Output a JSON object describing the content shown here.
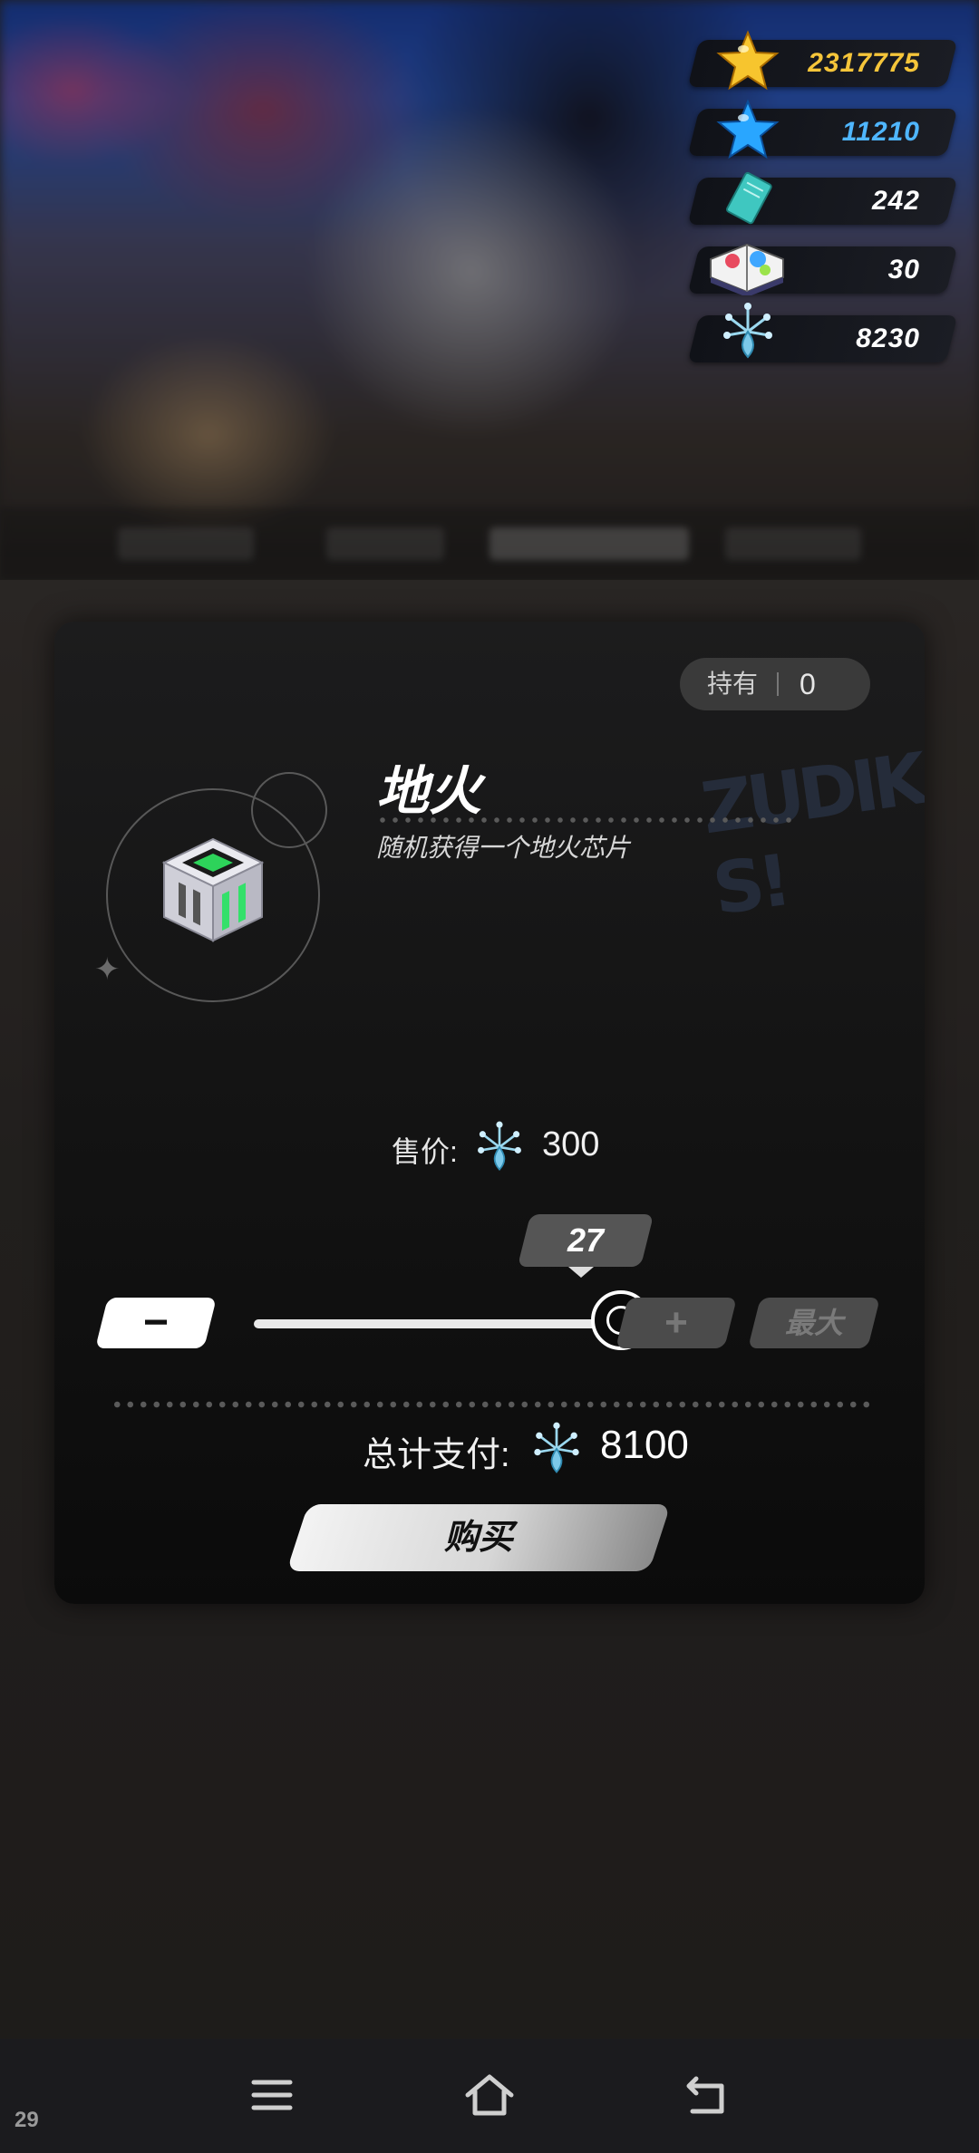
{
  "currencies": [
    {
      "name": "gold-star",
      "value": "2317775",
      "color": "#f5c53a"
    },
    {
      "name": "blue-star",
      "value": "11210",
      "color": "#4fb6ff"
    },
    {
      "name": "card",
      "value": "242",
      "color": "#ffffff"
    },
    {
      "name": "book",
      "value": "30",
      "color": "#ffffff"
    },
    {
      "name": "crystal",
      "value": "8230",
      "color": "#ffffff"
    }
  ],
  "dialog": {
    "hold_label": "持有",
    "hold_value": "0",
    "item_name": "地火",
    "item_desc": "随机获得一个地火芯片",
    "price_label": "售价:",
    "price_value": "300",
    "quantity": "27",
    "quantity_max": "30",
    "slider_fraction": 0.9,
    "minus_label": "−",
    "plus_label": "+",
    "max_label": "最大",
    "total_label": "总计支付:",
    "total_value": "8100",
    "buy_label": "购买"
  },
  "status": {
    "fps": "29"
  },
  "icons": {
    "nav": [
      "menu-icon",
      "home-icon",
      "back-icon"
    ],
    "currency": [
      "gold-star-icon",
      "blue-star-icon",
      "card-icon",
      "book-icon",
      "crystal-icon"
    ]
  }
}
